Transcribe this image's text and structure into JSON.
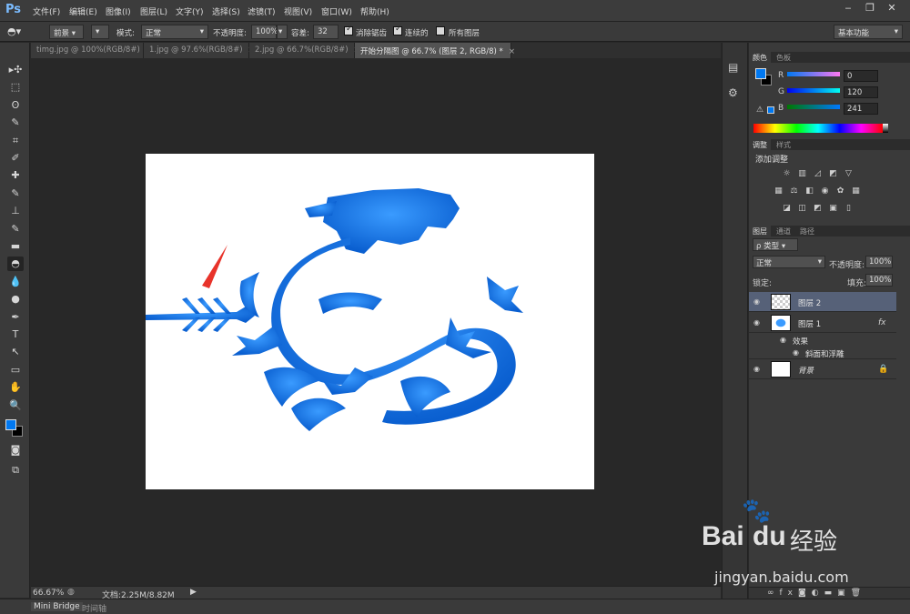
{
  "app": {
    "logo": "Ps"
  },
  "menu": [
    "文件(F)",
    "编辑(E)",
    "图像(I)",
    "图层(L)",
    "文字(Y)",
    "选择(S)",
    "滤镜(T)",
    "视图(V)",
    "窗口(W)",
    "帮助(H)"
  ],
  "options": {
    "fill_source": "前景",
    "mode_label": "模式:",
    "mode_value": "正常",
    "opacity_label": "不透明度:",
    "opacity_value": "100%",
    "tolerance_label": "容差:",
    "tolerance_value": "32",
    "antialias_label": "消除锯齿",
    "antialias_checked": true,
    "contiguous_label": "连续的",
    "contiguous_checked": true,
    "all_layers_label": "所有图层",
    "all_layers_checked": false,
    "workspace": "基本功能"
  },
  "tabs": [
    {
      "label": "timg.jpg @ 100%(RGB/8#)",
      "active": false
    },
    {
      "label": "1.jpg @ 97.6%(RGB/8#)",
      "active": false
    },
    {
      "label": "2.jpg @ 66.7%(RGB/8#)",
      "active": false
    },
    {
      "label": "开始分隔图 @ 66.7% (图层 2, RGB/8) *",
      "active": true
    }
  ],
  "tools": [
    "move-icon",
    "marquee-icon",
    "lasso-icon",
    "quick-select-icon",
    "crop-icon",
    "eyedropper-icon",
    "healing-icon",
    "brush-icon",
    "stamp-icon",
    "history-brush-icon",
    "eraser-icon",
    "paint-bucket-icon",
    "blur-icon",
    "dodge-icon",
    "pen-icon",
    "type-icon",
    "path-select-icon",
    "shape-icon",
    "hand-icon",
    "zoom-icon"
  ],
  "tool_glyphs": [
    "▸✣",
    "⬚",
    "ʘ",
    "✎",
    "⌗",
    "✐",
    "✚",
    "✎",
    "⊥",
    "✎",
    "▬",
    "◓",
    "💧",
    "●",
    "✒",
    "T",
    "↖",
    "▭",
    "✋",
    "🔍"
  ],
  "status": {
    "zoom": "66.67%",
    "doc": "文档:2.25M/8.82M"
  },
  "bottom_tabs": [
    "Mini Bridge",
    "时间轴"
  ],
  "color_panel": {
    "tabs": [
      "颜色",
      "色板"
    ],
    "r_label": "R",
    "r_value": "0",
    "g_label": "G",
    "g_value": "120",
    "b_label": "B",
    "b_value": "241",
    "fg_color": "#0078f1"
  },
  "adjust_panel": {
    "tabs": [
      "调整",
      "样式"
    ],
    "title": "添加调整"
  },
  "layers_panel": {
    "tabs": [
      "图层",
      "通道",
      "路径"
    ],
    "filter_label": "类型",
    "blend_mode": "正常",
    "opacity_label": "不透明度:",
    "opacity_value": "100%",
    "lock_label": "锁定:",
    "fill_label": "填充:",
    "fill_value": "100%",
    "layers": [
      {
        "name": "图层 2",
        "selected": true
      },
      {
        "name": "图层 1",
        "selected": false,
        "fx": "fx"
      },
      {
        "name": "效果",
        "sub": true
      },
      {
        "name": "斜面和浮雕",
        "sub": true
      },
      {
        "name": "背景",
        "selected": false,
        "locked": true
      }
    ]
  },
  "watermark": {
    "brand": "Bai",
    "brand2": "du",
    "brand_cn": "经验",
    "url": "jingyan.baidu.com"
  },
  "colors": {
    "accent": "#0078f1",
    "panel": "#3a3a3a",
    "bg": "#282828",
    "arrow": "#e8332a"
  }
}
